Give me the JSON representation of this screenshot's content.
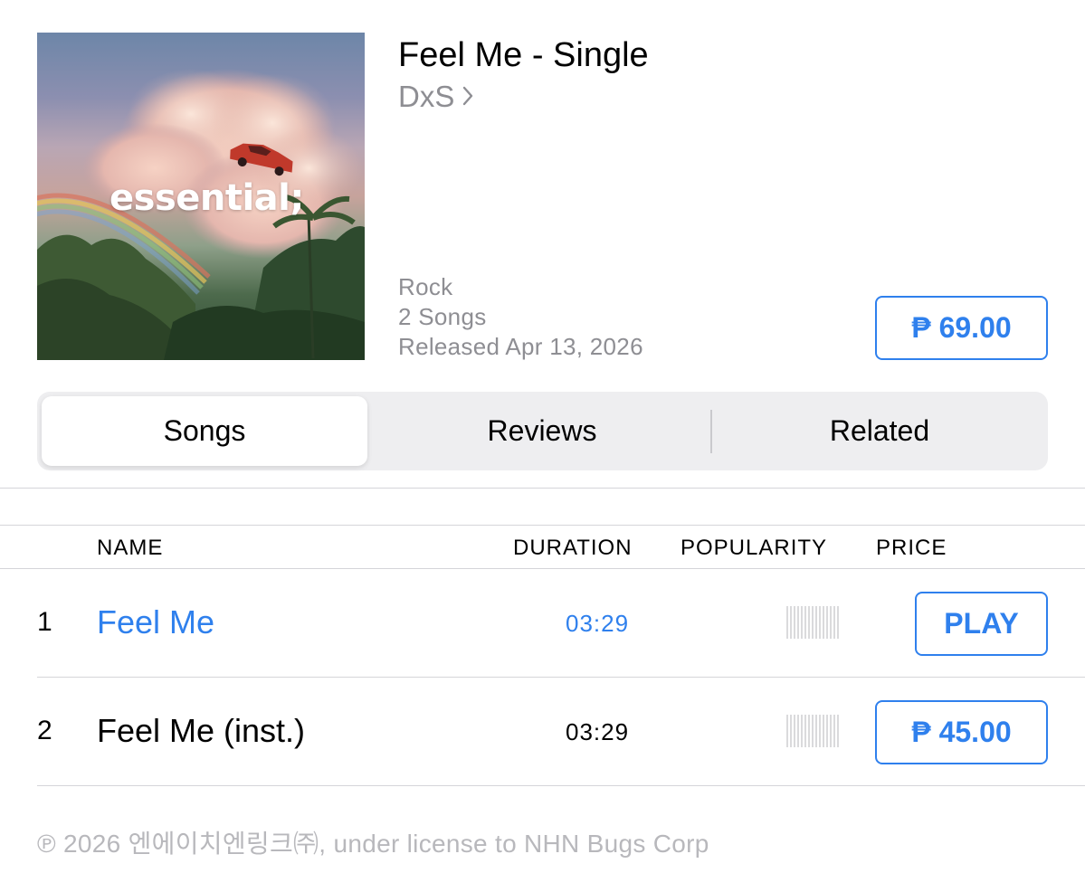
{
  "album": {
    "title": "Feel Me - Single",
    "artist": "DxS",
    "genre": "Rock",
    "song_count": "2 Songs",
    "released": "Released Apr 13, 2026",
    "price": "₱ 69.00",
    "art_wordmark": "essential;"
  },
  "tabs": [
    {
      "label": "Songs",
      "selected": true
    },
    {
      "label": "Reviews",
      "selected": false
    },
    {
      "label": "Related",
      "selected": false
    }
  ],
  "table": {
    "headers": {
      "name": "NAME",
      "duration": "DURATION",
      "popularity": "POPULARITY",
      "price": "PRICE"
    },
    "rows": [
      {
        "number": "1",
        "name": "Feel Me",
        "duration": "03:29",
        "action": "PLAY",
        "playing": true,
        "popularity_fraction": 0
      },
      {
        "number": "2",
        "name": "Feel Me (inst.)",
        "duration": "03:29",
        "action": "₱ 45.00",
        "playing": false,
        "popularity_fraction": 0
      }
    ]
  },
  "footer": {
    "copyright": "℗ 2026 엔에이치엔링크㈜, under license to NHN Bugs Corp"
  },
  "colors": {
    "accent": "#2f80ed",
    "secondary_text": "#8e8e93",
    "segmented_bg": "#eeeef0"
  },
  "icons": {
    "artist_chevron": "chevron-right-icon",
    "popularity": "popularity-bars-icon"
  }
}
